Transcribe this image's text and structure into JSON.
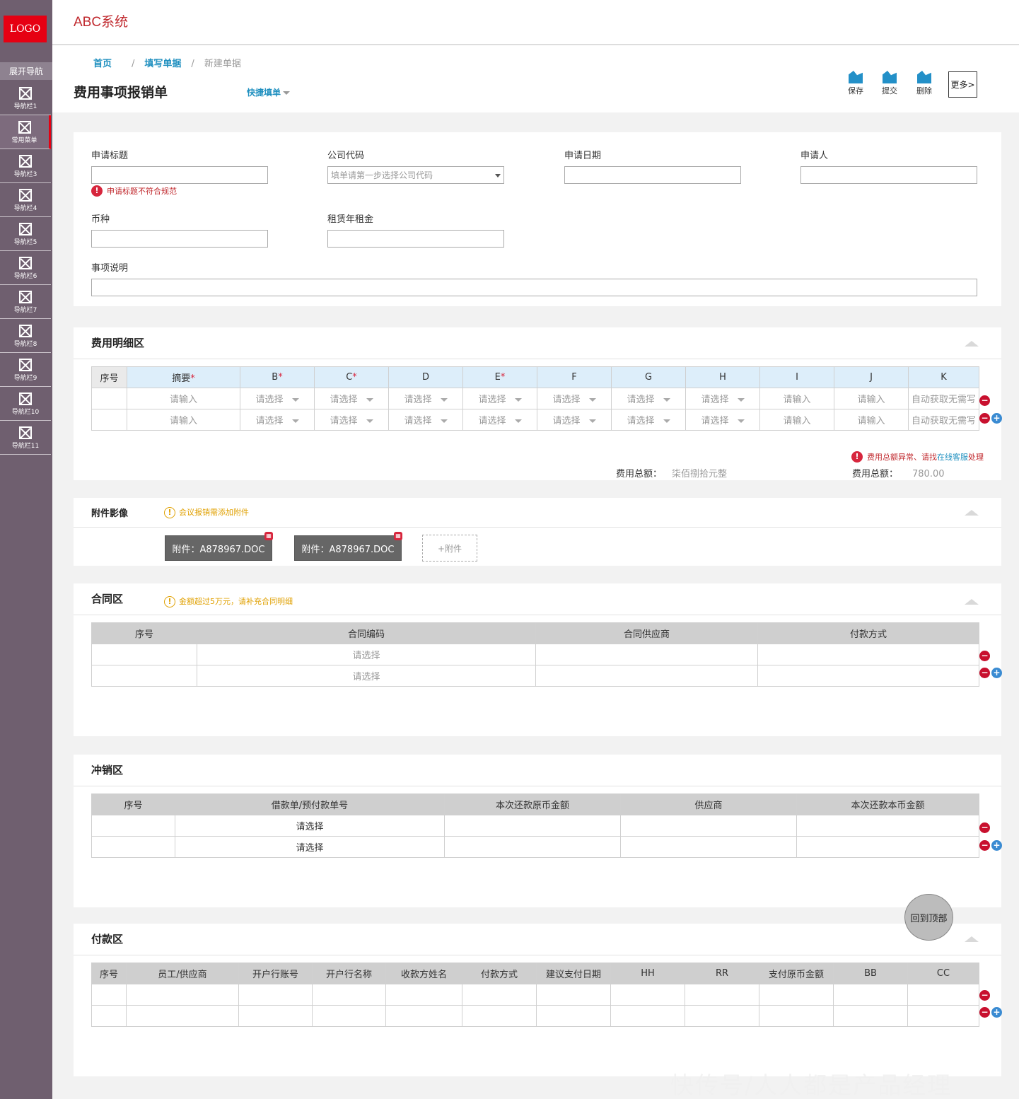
{
  "app": {
    "logo": "LOGO",
    "brand": "ABC系统"
  },
  "sidebar": {
    "expand_label": "展开导航",
    "items": [
      {
        "label": "导航栏1"
      },
      {
        "label": "常用菜单"
      },
      {
        "label": "导航栏3"
      },
      {
        "label": "导航栏4"
      },
      {
        "label": "导航栏5"
      },
      {
        "label": "导航栏6"
      },
      {
        "label": "导航栏7"
      },
      {
        "label": "导航栏8"
      },
      {
        "label": "导航栏9"
      },
      {
        "label": "导航栏10"
      },
      {
        "label": "导航栏11"
      }
    ]
  },
  "breadcrumb": {
    "home": "首页",
    "level2": "填写单据",
    "current": "新建单据",
    "sep": "/"
  },
  "page": {
    "title": "费用事项报销单",
    "quick_fill": "快捷填单"
  },
  "toolbar": {
    "save": "保存",
    "submit": "提交",
    "delete": "删除",
    "more": "更多>"
  },
  "form": {
    "title_label": "申请标题",
    "company_label": "公司代码",
    "company_placeholder": "填单请第一步选择公司代码",
    "date_label": "申请日期",
    "applicant_label": "申请人",
    "title_error": "申请标题不符合规范",
    "currency_label": "币种",
    "rent_label": "租赁年租金",
    "desc_label": "事项说明"
  },
  "expense": {
    "title": "费用明细区",
    "headers": [
      "序号",
      "摘要",
      "B",
      "C",
      "D",
      "E",
      "F",
      "G",
      "H",
      "I",
      "J",
      "K"
    ],
    "input_ph": "请输入",
    "select_ph": "请选择",
    "auto_ph": "自动获取无需写",
    "error_pre": "费用总额异常、请找",
    "error_link": "在线客服",
    "error_post": "处理",
    "total_label": "费用总额：",
    "total_words": "柒佰捌拾元整",
    "total_label2": "费用总额：",
    "total_value": "780.00"
  },
  "attachments": {
    "title": "附件影像",
    "warning": "会议报销需添加附件",
    "files": [
      "附件：A878967.DOC",
      "附件：A878967.DOC"
    ],
    "add_label": "+附件"
  },
  "contract": {
    "title": "合同区",
    "warning": "金额超过5万元，请补充合同明细",
    "headers": [
      "序号",
      "合同编码",
      "合同供应商",
      "付款方式"
    ],
    "select_ph": "请选择"
  },
  "writeoff": {
    "title": "冲销区",
    "headers": [
      "序号",
      "借款单/预付款单号",
      "本次还款原币金额",
      "供应商",
      "本次还款本币金额"
    ],
    "select_ph": "请选择"
  },
  "payment": {
    "title": "付款区",
    "headers": [
      "序号",
      "员工/供应商",
      "开户行账号",
      "开户行名称",
      "收款方姓名",
      "付款方式",
      "建议支付日期",
      "HH",
      "RR",
      "支付原币金额",
      "BB",
      "CC"
    ]
  },
  "back_to_top": "回到顶部",
  "watermark": "快传号/人人都是产品经理",
  "colors": {
    "brand": "#c0282d",
    "sidebar": "#6f5f6f",
    "accent": "#1e8fbf",
    "logo_bg": "#e60012"
  }
}
